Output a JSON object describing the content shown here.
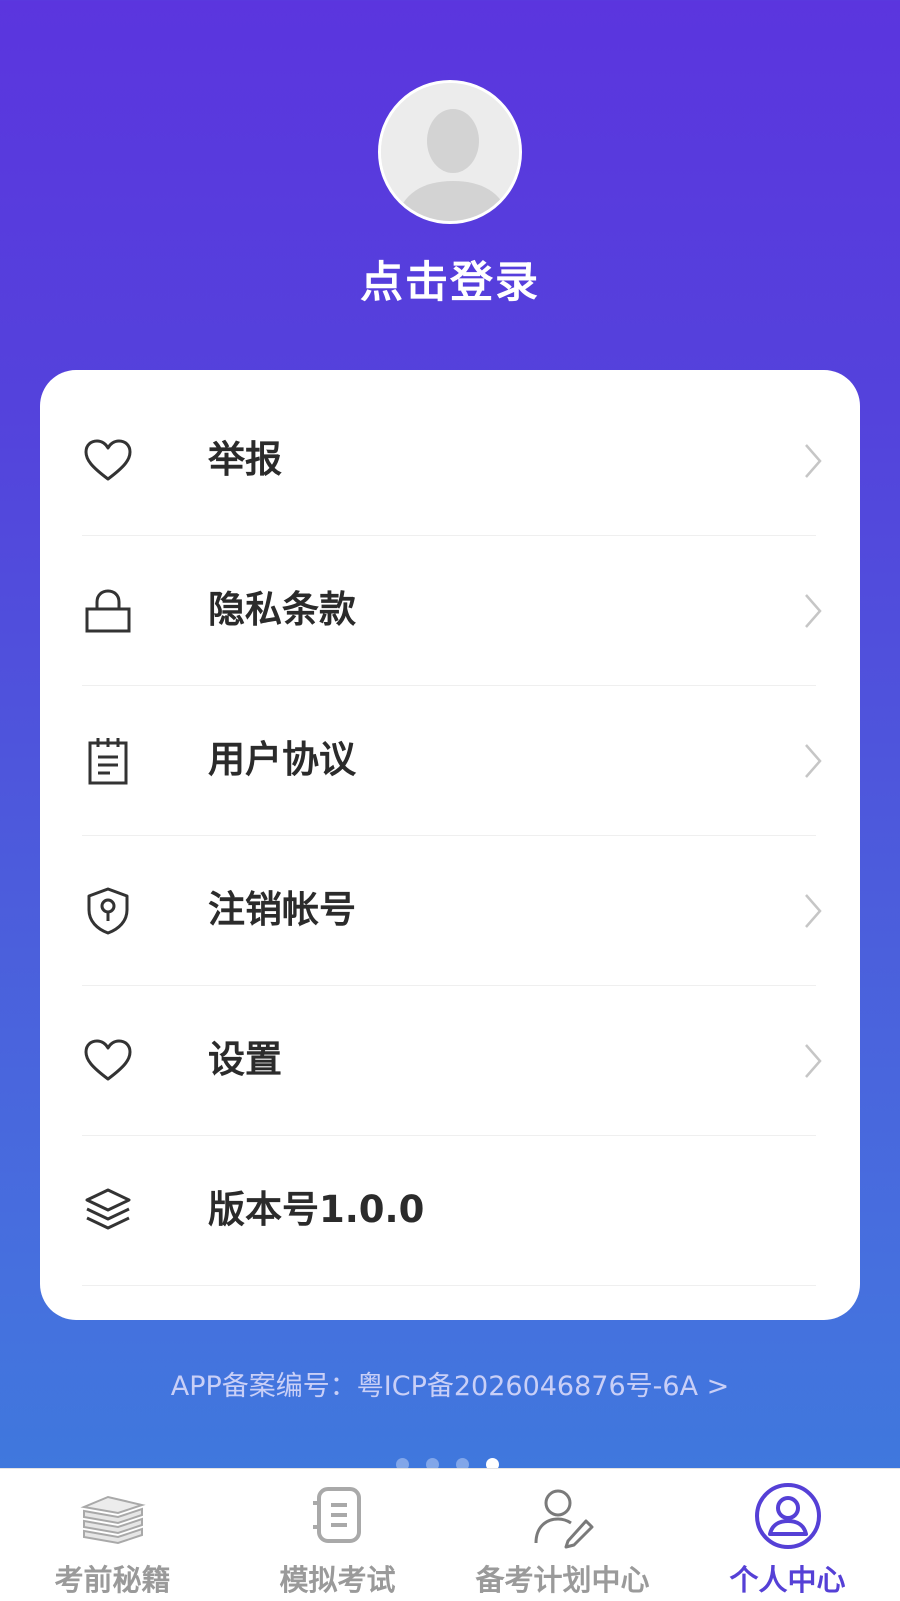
{
  "profile": {
    "login_label": "点击登录"
  },
  "menu": {
    "items": [
      {
        "label": "举报",
        "icon": "heart-icon"
      },
      {
        "label": "隐私条款",
        "icon": "lock-icon"
      },
      {
        "label": "用户协议",
        "icon": "notepad-icon"
      },
      {
        "label": "注销帐号",
        "icon": "shield-keyhole-icon"
      },
      {
        "label": "设置",
        "icon": "heart-icon"
      },
      {
        "label": "版本号1.0.0",
        "icon": "layers-icon"
      }
    ]
  },
  "footer": {
    "icp_text": "APP备案编号：粤ICP备2026046876号-6A >"
  },
  "pager": {
    "count": 4,
    "active_index": 3
  },
  "tabbar": {
    "tabs": [
      {
        "label": "考前秘籍",
        "icon": "books-icon",
        "active": false
      },
      {
        "label": "模拟考试",
        "icon": "notebook-icon",
        "active": false
      },
      {
        "label": "备考计划中心",
        "icon": "user-pen-icon",
        "active": false
      },
      {
        "label": "个人中心",
        "icon": "user-circle-icon",
        "active": true
      }
    ]
  },
  "colors": {
    "accent": "#5540d6",
    "gradient_top": "#5b35de",
    "gradient_bottom": "#3f78dd",
    "inactive": "#9a9a9a"
  }
}
